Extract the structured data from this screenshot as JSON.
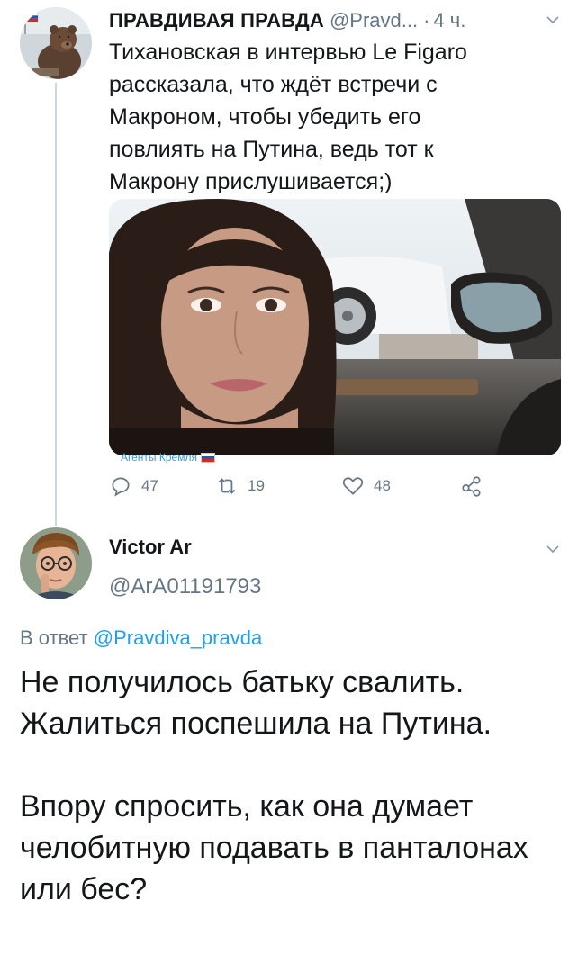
{
  "tweet1": {
    "author_name": "ПРАВДИВАЯ ПРАВДА",
    "author_handle": "@Pravd...",
    "dot": "·",
    "time": "4 ч.",
    "text": "Тихановская в интервью Le Figaro рассказала, что ждёт встречи с Макроном, чтобы убедить его повлиять на Путина, ведь тот к Макрону прислушивается;)",
    "media_watermark": "Агенты Кремля",
    "replies": "47",
    "retweets": "19",
    "likes": "48"
  },
  "tweet2": {
    "author_name": "Victor Ar",
    "author_handle": "@ArA01191793",
    "reply_prefix": "В ответ",
    "reply_handle": "@Pravdiva_pravda",
    "paragraph1": "Не получилось батьку свалить. Жалиться поспешила на Путина.",
    "paragraph2": "Впору спросить, как она думает челобитную подавать в панталонах или бес?"
  },
  "icons": {
    "reply": "reply-icon",
    "retweet": "retweet-icon",
    "like": "heart-icon",
    "share": "share-icon",
    "menu": "chevron-down-icon"
  },
  "colors": {
    "link": "#1da1f2",
    "muted": "#657786",
    "text": "#14171a",
    "thread_line": "#ccd6dd"
  }
}
